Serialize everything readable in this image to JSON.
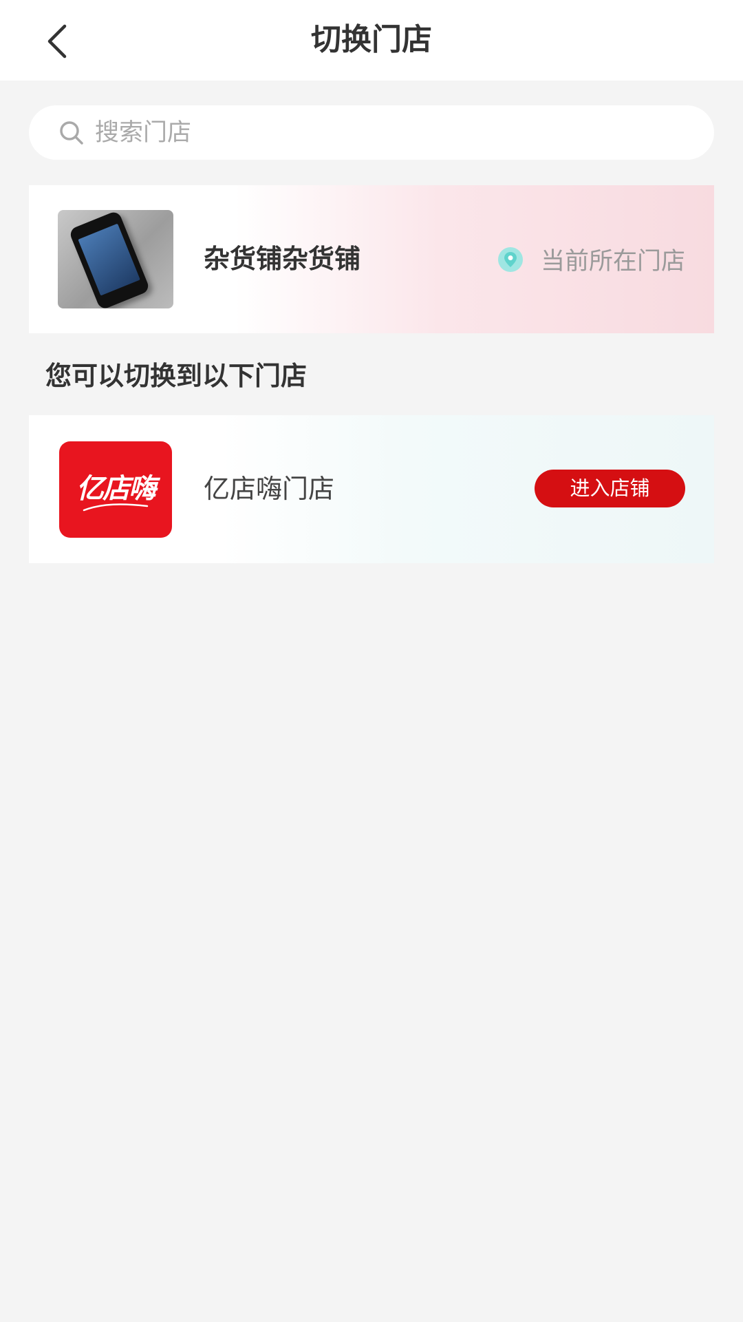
{
  "header": {
    "title": "切换门店",
    "back_icon": "chevron-left-icon"
  },
  "search": {
    "placeholder": "搜索门店",
    "value": "",
    "icon": "search-icon"
  },
  "current_store": {
    "name": "杂货铺杂货铺",
    "tag_label": "当前所在门店",
    "tag_icon": "location-pin-icon",
    "tag_icon_color": "#9fe6e2"
  },
  "section": {
    "title": "您可以切换到以下门店"
  },
  "stores": [
    {
      "name": "亿店嗨门店",
      "logo_text": "亿店嗨",
      "logo_color": "#e8151f",
      "button_label": "进入店铺",
      "button_color": "#d50f12"
    }
  ]
}
